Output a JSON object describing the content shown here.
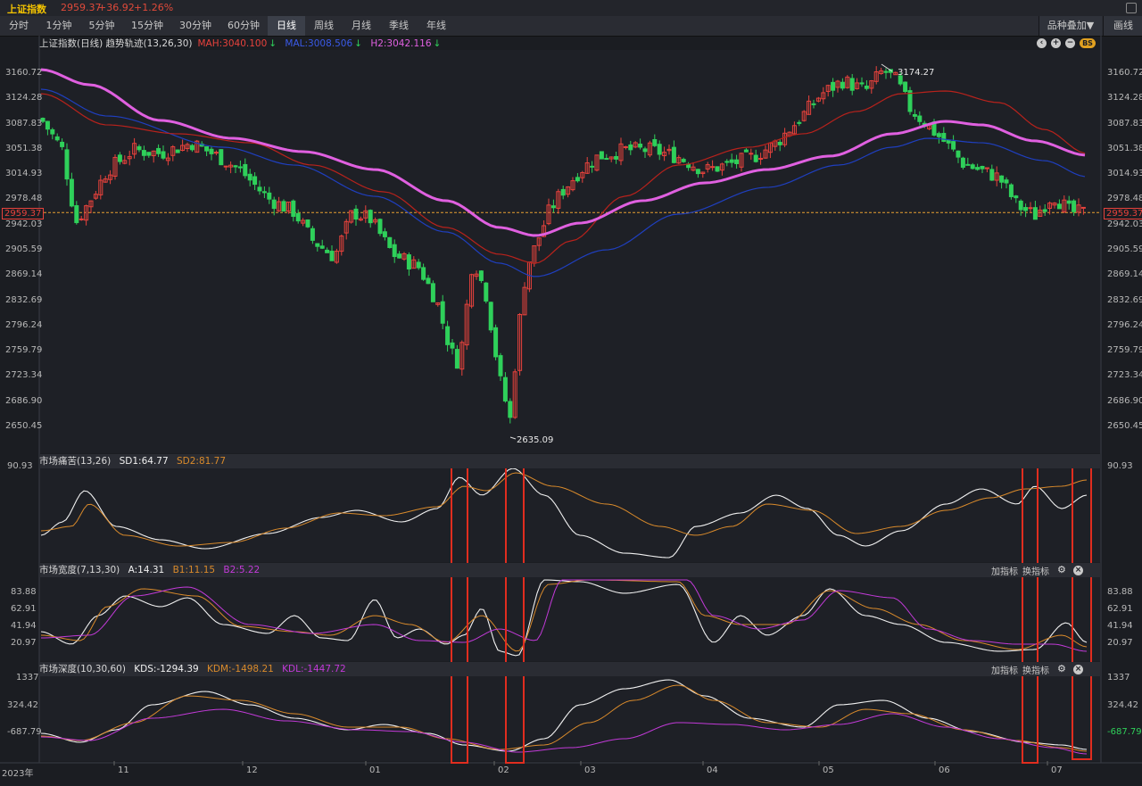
{
  "topbar": {
    "name": "上证指数",
    "price": "2959.37",
    "change": "+36.92",
    "pct": "+1.26%"
  },
  "tabs": [
    "分时",
    "1分钟",
    "5分钟",
    "15分钟",
    "30分钟",
    "60分钟",
    "日线",
    "周线",
    "月线",
    "季线",
    "年线"
  ],
  "active_tab": "日线",
  "toolbar": {
    "overlay_label": "品种叠加▼",
    "draw_label": "画线"
  },
  "main_head": {
    "title": "上证指数(日线) 趋势轨迹(13,26,30)",
    "mah": "MAH:3040.100",
    "mal": "MAL:3008.506",
    "h2": "H2:3042.116",
    "bs": "BS"
  },
  "pain_head": {
    "title": "市场痛苦(13,26)",
    "sd1": "SD1:64.77",
    "sd2": "SD2:81.77"
  },
  "breadth_head": {
    "title": "市场宽度(7,13,30)",
    "a": "A:14.31",
    "b1": "B1:11.15",
    "b2": "B2:5.22",
    "add": "加指标",
    "swap": "换指标"
  },
  "depth_head": {
    "title": "市场深度(10,30,60)",
    "kds": "KDS:-1294.39",
    "kdm": "KDM:-1498.21",
    "kdl": "KDL:-1447.72",
    "add": "加指标",
    "swap": "换指标"
  },
  "price_ticks": [
    "3160.72",
    "3124.28",
    "3087.83",
    "3051.38",
    "3014.93",
    "2978.48",
    "2942.03",
    "2905.59",
    "2869.14",
    "2832.69",
    "2796.24",
    "2759.79",
    "2723.34",
    "2686.90",
    "2650.45"
  ],
  "current_price_tag": "2959.37",
  "high_label": "3174.27",
  "low_label": "2635.09",
  "pain_ticks": [
    "90.93"
  ],
  "breadth_ticks": [
    "83.88",
    "62.91",
    "41.94",
    "20.97"
  ],
  "depth_ticks": [
    "1337",
    "324.42",
    "-687.79"
  ],
  "depth_right_last": "-687.79",
  "x_labels": [
    "2023年",
    "11",
    "12",
    "01",
    "02",
    "03",
    "04",
    "05",
    "06",
    "07"
  ],
  "colors": {
    "up": "#e8423c",
    "down": "#2fd05a",
    "pink": "#e060e0",
    "blue": "#1f3fbf",
    "redline": "#b8221c",
    "orange": "#d98a2b",
    "white": "#f0f0f0",
    "magenta": "#c23ad8",
    "highlight": "#e02d1f"
  },
  "chart_data": [
    {
      "type": "candlestick",
      "title": "上证指数(日线)",
      "ylim": [
        2630,
        3175
      ],
      "x": [
        "2023-10",
        "2023-11",
        "2023-12",
        "2024-01",
        "2024-02",
        "2024-03",
        "2024-04",
        "2024-05",
        "2024-06",
        "2024-07"
      ],
      "close_approx": [
        3095,
        3060,
        3040,
        2985,
        2945,
        2970,
        2960,
        2880,
        2800,
        2700,
        2640,
        2880,
        2990,
        3050,
        3070,
        3020,
        3030,
        3070,
        3120,
        3150,
        3160,
        3100,
        3060,
        3020,
        2990,
        2960,
        2940,
        2959.37
      ],
      "high": 3174.27,
      "low": 2635.09,
      "series": [
        {
          "name": "MAH",
          "last": 3040.1
        },
        {
          "name": "MAL",
          "last": 3008.506
        },
        {
          "name": "H2",
          "last": 3042.116
        }
      ]
    },
    {
      "type": "line",
      "title": "市场痛苦(13,26)",
      "series": [
        {
          "name": "SD1",
          "last": 64.77
        },
        {
          "name": "SD2",
          "last": 81.77
        }
      ]
    },
    {
      "type": "line",
      "title": "市场宽度(7,13,30)",
      "series": [
        {
          "name": "A",
          "last": 14.31
        },
        {
          "name": "B1",
          "last": 11.15
        },
        {
          "name": "B2",
          "last": 5.22
        }
      ]
    },
    {
      "type": "line",
      "title": "市场深度(10,30,60)",
      "series": [
        {
          "name": "KDS",
          "last": -1294.39
        },
        {
          "name": "KDM",
          "last": -1498.21
        },
        {
          "name": "KDL",
          "last": -1447.72
        }
      ]
    }
  ]
}
